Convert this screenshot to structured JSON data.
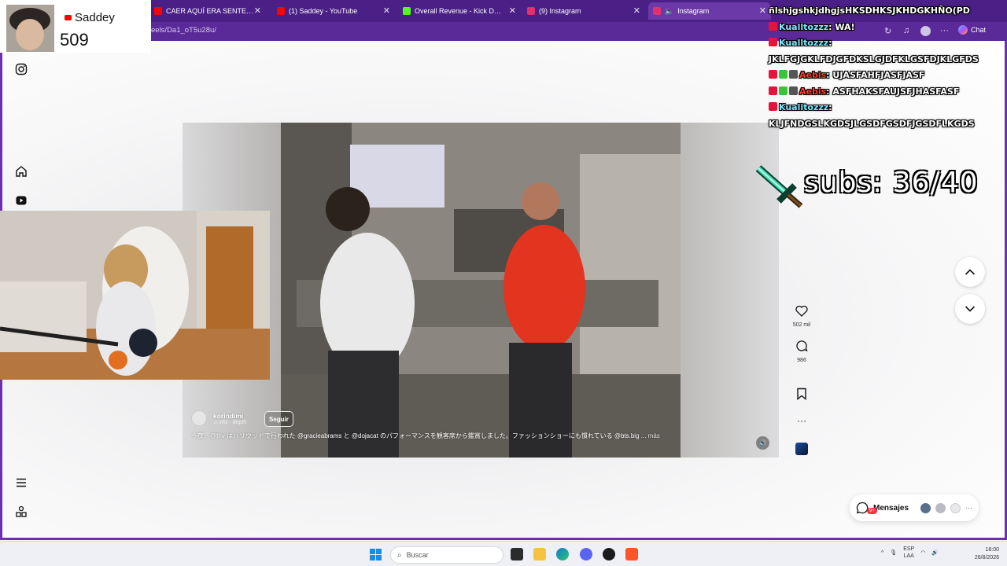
{
  "browser": {
    "tabs": [
      {
        "title": "CAER AQUÍ ERA SENTENCIA DE M",
        "favicon": "youtube-icon",
        "color": "#ff0000"
      },
      {
        "title": "(1) Saddey - YouTube",
        "favicon": "youtube-icon",
        "color": "#ff0000"
      },
      {
        "title": "Overall Revenue - Kick Dashboard",
        "favicon": "kick-icon",
        "color": "#53fc18"
      },
      {
        "title": "(9) Instagram",
        "favicon": "instagram-icon",
        "color": "#e1306c"
      },
      {
        "title": "Instagram",
        "favicon": "instagram-icon",
        "color": "#e1306c"
      }
    ],
    "url": "eels/Da1_oT5u28u/",
    "copilot_label": "Chat"
  },
  "instagram": {
    "reel": {
      "author": "korindimi",
      "music": "vrtx · depth",
      "follow_label": "Seguir",
      "caption": "今夜、@thv はハリウッドで行われた @gracieabrams と @dojacat のパフォーマンスを観客席から鑑賞しました。ファッションショーにも慣れている @bts.big",
      "more_label": "... más",
      "likes": "502 mil",
      "comments": "986"
    },
    "messages": {
      "label": "Mensajes",
      "badge": "9+"
    }
  },
  "overlay": {
    "youtube": {
      "channel": "Saddey",
      "subscribers": "509"
    },
    "chat": [
      {
        "user": "",
        "message": "ñlshjgshkjdhgjsHKSDHKSJKHDGKHÑO(PD",
        "user_color": "#7fe8ff"
      },
      {
        "user": "Kualltozzz",
        "message": "WA!",
        "user_color": "#7fe8ff"
      },
      {
        "user": "Kualltozzz",
        "message": "JKLFGJGKLFDJGFDKSLGJDFKLGSFDJKLGFDS",
        "user_color": "#7fe8ff"
      },
      {
        "user": "Aebis",
        "message": "UJASFAHFJASFJASF",
        "user_color": "#ff3b30"
      },
      {
        "user": "Aebis",
        "message": "ASFHAKSFAUJSFJHASFASF",
        "user_color": "#ff3b30"
      },
      {
        "user": "Kualitozzz",
        "message": "KLJFNDGSLKGDSJLGSDFGSDFJGSDFLKGDS",
        "user_color": "#7fe8ff"
      }
    ],
    "subs_goal": "subs: 36/40"
  },
  "taskbar": {
    "search_placeholder": "Buscar",
    "language": "ESP",
    "language_sub": "LAA",
    "time": "18:00",
    "date": "26/8/2026"
  }
}
